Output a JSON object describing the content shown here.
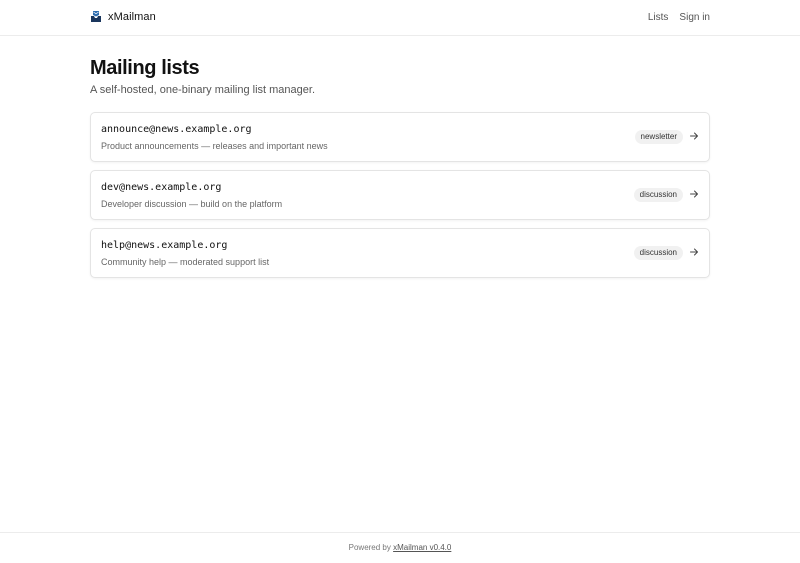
{
  "header": {
    "brand_name": "xMailman",
    "logo_icon": "mail-inbox-icon",
    "nav": [
      {
        "label": "Lists"
      },
      {
        "label": "Sign in"
      }
    ]
  },
  "main": {
    "title": "Mailing lists",
    "subtitle": "A self-hosted, one-binary mailing list manager.",
    "lists": [
      {
        "address": "announce@news.example.org",
        "description": "Product announcements — releases and important news",
        "badge": "newsletter",
        "arrow_icon": "arrow-right-icon"
      },
      {
        "address": "dev@news.example.org",
        "description": "Developer discussion — build on the platform",
        "badge": "discussion",
        "arrow_icon": "arrow-right-icon"
      },
      {
        "address": "help@news.example.org",
        "description": "Community help — moderated support list",
        "badge": "discussion",
        "arrow_icon": "arrow-right-icon"
      }
    ]
  },
  "footer": {
    "prefix": "Powered by",
    "link_label": "xMailman v0.4.0"
  },
  "colors": {
    "logo_blue": "#2b6cb0",
    "logo_dark": "#1a365d",
    "text": "#111111",
    "muted": "#666666",
    "border": "#e4e4e4",
    "badge_bg": "#f1f1f1"
  }
}
